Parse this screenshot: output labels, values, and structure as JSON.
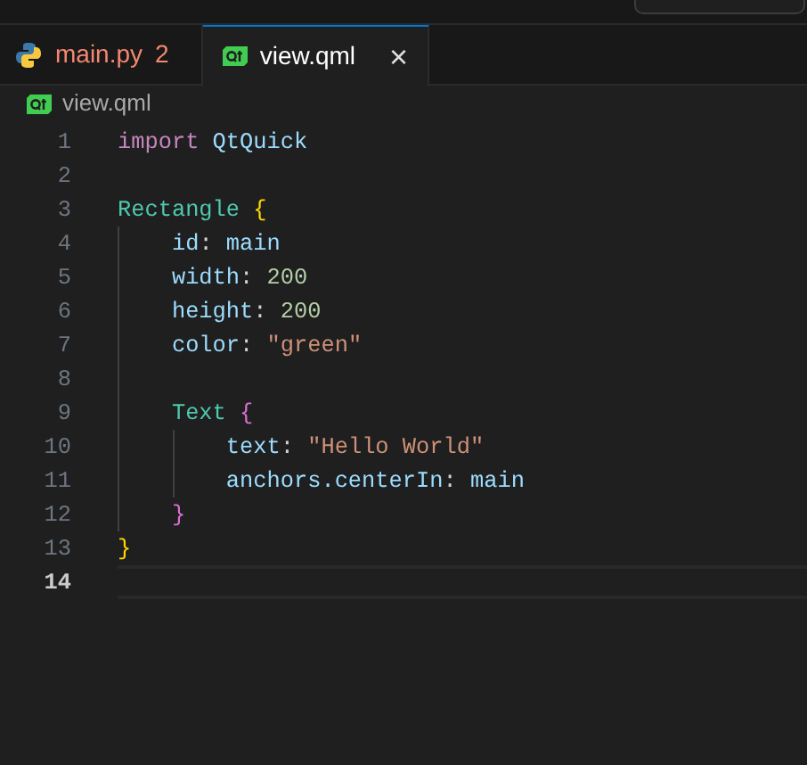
{
  "tabs": [
    {
      "label": "main.py",
      "kind": "python",
      "errors": true,
      "problems": "2",
      "selected": false
    },
    {
      "label": "view.qml",
      "kind": "qml",
      "errors": false,
      "close": "×",
      "selected": true
    }
  ],
  "breadcrumb": {
    "label": "view.qml"
  },
  "editor": {
    "lines": [
      {
        "number": "1",
        "current": false,
        "tokens": [
          {
            "text": "import",
            "kind": "keyword"
          },
          {
            "text": " QtQuick",
            "kind": "identifier"
          }
        ]
      },
      {
        "number": "2",
        "current": false
      },
      {
        "number": "3",
        "current": false,
        "tokens": [
          {
            "text": "Rectangle",
            "kind": "type"
          },
          {
            "text": " {",
            "kind": "bracket1"
          }
        ]
      },
      {
        "number": "4",
        "current": false,
        "tokens": [
          {
            "text": "    id",
            "kind": "identifier"
          },
          {
            "text": ":",
            "kind": "plain"
          },
          {
            "text": " main",
            "kind": "identifier"
          }
        ]
      },
      {
        "number": "5",
        "current": false,
        "tokens": [
          {
            "text": "    width",
            "kind": "identifier"
          },
          {
            "text": ":",
            "kind": "plain"
          },
          {
            "text": " 200",
            "kind": "number"
          }
        ]
      },
      {
        "number": "6",
        "current": false,
        "tokens": [
          {
            "text": "    height",
            "kind": "identifier"
          },
          {
            "text": ":",
            "kind": "plain"
          },
          {
            "text": " 200",
            "kind": "number"
          }
        ]
      },
      {
        "number": "7",
        "current": false,
        "tokens": [
          {
            "text": "    color",
            "kind": "identifier"
          },
          {
            "text": ":",
            "kind": "plain"
          },
          {
            "text": " \"green\"",
            "kind": "string"
          }
        ]
      },
      {
        "number": "8",
        "current": false
      },
      {
        "number": "9",
        "current": false,
        "tokens": [
          {
            "text": "    Text",
            "kind": "type"
          },
          {
            "text": " {",
            "kind": "bracket2"
          }
        ]
      },
      {
        "number": "10",
        "current": false,
        "tokens": [
          {
            "text": "        text",
            "kind": "identifier"
          },
          {
            "text": ":",
            "kind": "plain"
          },
          {
            "text": " \"Hello World\"",
            "kind": "string"
          }
        ]
      },
      {
        "number": "11",
        "current": false,
        "tokens": [
          {
            "text": "        anchors.centerIn",
            "kind": "identifier"
          },
          {
            "text": ":",
            "kind": "plain"
          },
          {
            "text": " main",
            "kind": "identifier"
          }
        ]
      },
      {
        "number": "12",
        "current": false,
        "tokens": [
          {
            "text": "    }",
            "kind": "bracket2"
          }
        ]
      },
      {
        "number": "13",
        "current": false,
        "tokens": [
          {
            "text": "}",
            "kind": "bracket1"
          }
        ]
      },
      {
        "number": "14",
        "current": true
      }
    ]
  }
}
